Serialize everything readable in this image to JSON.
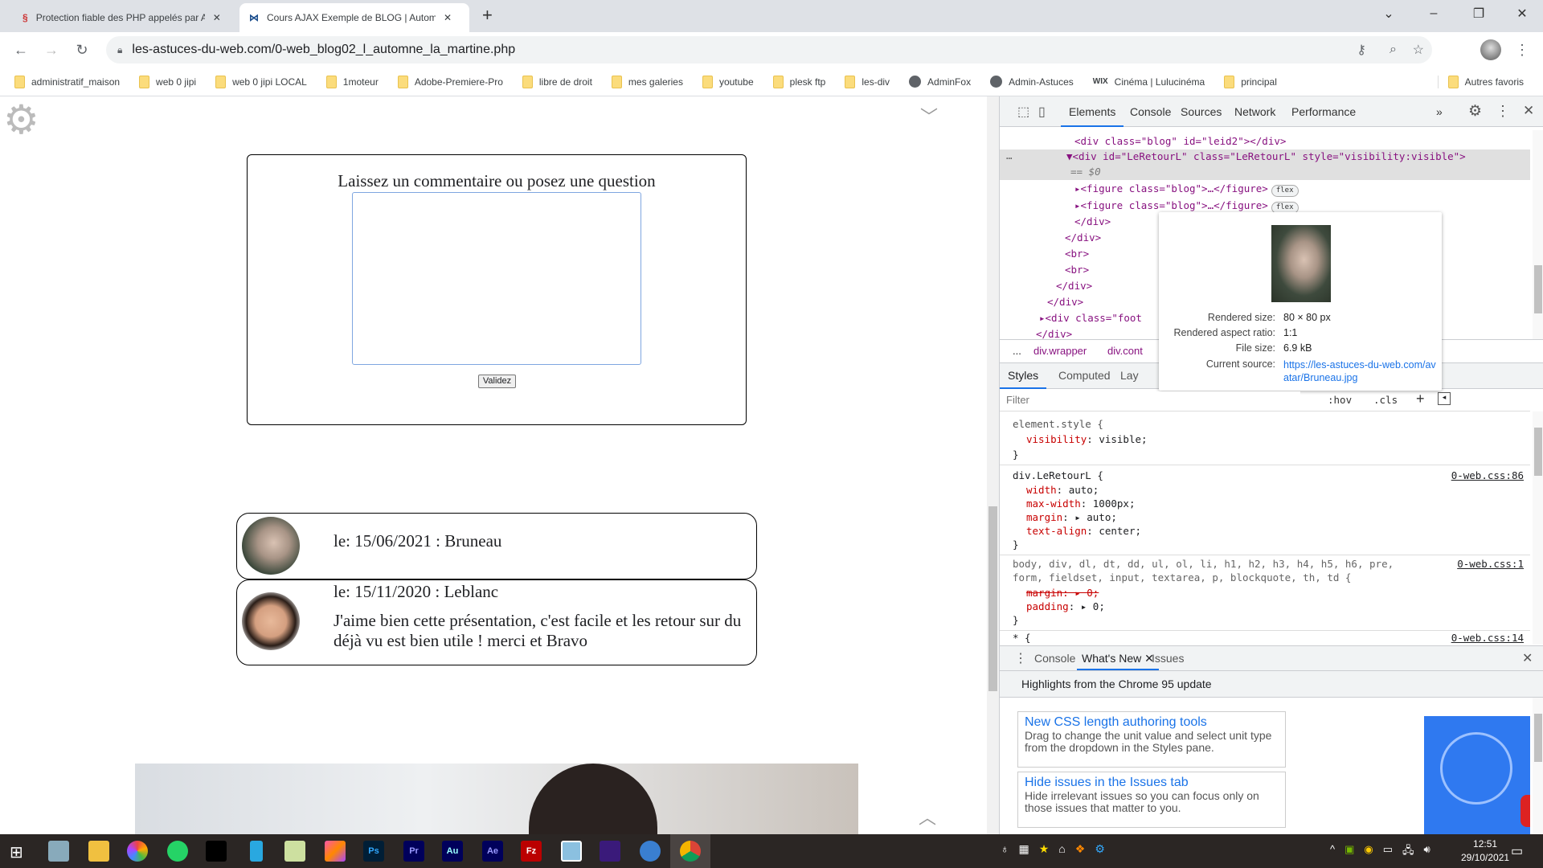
{
  "browser": {
    "tabs": [
      {
        "title": "Protection fiable des PHP appelés par A",
        "active": false
      },
      {
        "title": "Cours AJAX Exemple de BLOG | Automn",
        "active": true
      }
    ],
    "url": "les-astuces-du-web.com/0-web_blog02_l_automne_la_martine.php",
    "bookmarks": [
      {
        "label": "administratif_maison",
        "icon": "folder-icon"
      },
      {
        "label": "web 0 jipi",
        "icon": "folder-icon"
      },
      {
        "label": "web 0 jipi LOCAL",
        "icon": "folder-icon"
      },
      {
        "label": "1moteur",
        "icon": "folder-icon"
      },
      {
        "label": "Adobe-Premiere-Pro",
        "icon": "folder-icon"
      },
      {
        "label": "libre de droit",
        "icon": "folder-icon"
      },
      {
        "label": "mes galeries",
        "icon": "folder-icon"
      },
      {
        "label": "youtube",
        "icon": "folder-icon"
      },
      {
        "label": "plesk ftp",
        "icon": "folder-icon"
      },
      {
        "label": "les-div",
        "icon": "folder-icon"
      },
      {
        "label": "AdminFox",
        "icon": "globe-icon"
      },
      {
        "label": "Admin-Astuces",
        "icon": "globe-icon"
      },
      {
        "label": "Cinéma | Lulucinéma",
        "icon": "wix-icon"
      },
      {
        "label": "principal",
        "icon": "folder-icon"
      }
    ],
    "other_bookmarks": "Autres favoris",
    "wix_text": "WIX"
  },
  "page": {
    "form_title": "Laissez un commentaire ou posez une question",
    "textarea_value": "",
    "submit_label": "Validez",
    "comments": [
      {
        "header": "le: 15/06/2021 : Bruneau",
        "body": ""
      },
      {
        "header": "le: 15/11/2020 : Leblanc",
        "body": "J'aime bien cette présentation, c'est facile et les retour sur du déjà vu est bien utile ! merci et Bravo"
      }
    ]
  },
  "devtools": {
    "tabs": [
      "Elements",
      "Console",
      "Sources",
      "Network",
      "Performance"
    ],
    "active_tab": "Elements",
    "dom_lines": [
      "<div class=\"blog\" id=\"leid2\"></div>",
      "<div id=\"LeRetourL\" class=\"LeRetourL\" style=\"visibility:visible\">",
      "== $0",
      "<figure class=\"blog\">…</figure>",
      "<figure class=\"blog\">…</figure>",
      "</div>",
      "</div>",
      "<br>",
      "<br>",
      "</div>",
      "</div>",
      "<div class=\"foot",
      "</div>"
    ],
    "flex_badge": "flex",
    "popover": {
      "rendered_size_label": "Rendered size:",
      "rendered_size": "80 × 80 px",
      "aspect_label": "Rendered aspect ratio:",
      "aspect": "1:1",
      "file_size_label": "File size:",
      "file_size": "6.9 kB",
      "source_label": "Current source:",
      "source": "https://les-astuces-du-web.com/avatar/Bruneau.jpg"
    },
    "breadcrumbs": [
      "...",
      "div.wrapper",
      "div.cont"
    ],
    "style_tabs": [
      "Styles",
      "Computed",
      "Lay"
    ],
    "filter_placeholder": "Filter",
    "hov": ":hov",
    "cls": ".cls",
    "rules": {
      "r1_sel": "element.style {",
      "r1_p1": "visibility",
      "r1_v1": ": visible;",
      "r2_sel": "div.LeRetourL {",
      "r2_src": "0-web.css:86",
      "r2_p1": "width",
      "r2_v1": ": auto;",
      "r2_p2": "max-width",
      "r2_v2": ": 1000px;",
      "r2_p3": "margin",
      "r2_v3": ": ▸ auto;",
      "r2_p4": "text-align",
      "r2_v4": ": center;",
      "r3_sel": "body, div, dl, dt, dd, ul, ol, li, h1, h2, h3, h4, h5, h6, pre,",
      "r3_sel2": "form, fieldset, input, textarea, p, blockquote, th, td {",
      "r3_src": "0-web.css:1",
      "r3_p1": "margin: ▸ 0;",
      "r3_p2": "padding",
      "r3_v2": ": ▸ 0;",
      "r4_sel": "* {",
      "r4_src": "0-web.css:14",
      "close": "}"
    },
    "drawer": {
      "tabs": [
        "Console",
        "What's New",
        "Issues"
      ],
      "active": "What's New",
      "highlight": "Highlights from the Chrome 95 update",
      "cards": [
        {
          "title": "New CSS length authoring tools",
          "desc": "Drag to change the unit value and select unit type from the dropdown in the Styles pane."
        },
        {
          "title": "Hide issues in the Issues tab",
          "desc": "Hide irrelevant issues so you can focus only on those issues that matter to you."
        }
      ]
    }
  },
  "taskbar": {
    "apps": [
      {
        "icon": "files-icon",
        "label": ""
      },
      {
        "icon": "file-explorer-icon",
        "label": ""
      },
      {
        "icon": "picasa-icon",
        "label": ""
      },
      {
        "icon": "whatsapp-icon",
        "label": ""
      },
      {
        "icon": "terminal-icon",
        "label": ""
      },
      {
        "icon": "phone-icon",
        "label": ""
      },
      {
        "icon": "notepad-icon",
        "label": ""
      },
      {
        "icon": "creative-cloud-icon",
        "label": ""
      },
      {
        "icon": "photoshop-icon",
        "label": "Ps"
      },
      {
        "icon": "premiere-icon",
        "label": "Pr"
      },
      {
        "icon": "audition-icon",
        "label": "Au"
      },
      {
        "icon": "after-effects-icon",
        "label": "Ae"
      },
      {
        "icon": "filezilla-icon",
        "label": "Fz"
      },
      {
        "icon": "film-icon",
        "label": ""
      },
      {
        "icon": "video-editor-icon",
        "label": ""
      },
      {
        "icon": "thunderbird-icon",
        "label": ""
      },
      {
        "icon": "chrome-icon",
        "label": ""
      }
    ],
    "time": "12:51",
    "date": "29/10/2021"
  },
  "colors": {
    "accent": "#1a73e8",
    "devtools_tag": "#881280",
    "devtools_attr": "#994500",
    "devtools_val": "#1a1aa6",
    "css_prop": "#c80000"
  }
}
